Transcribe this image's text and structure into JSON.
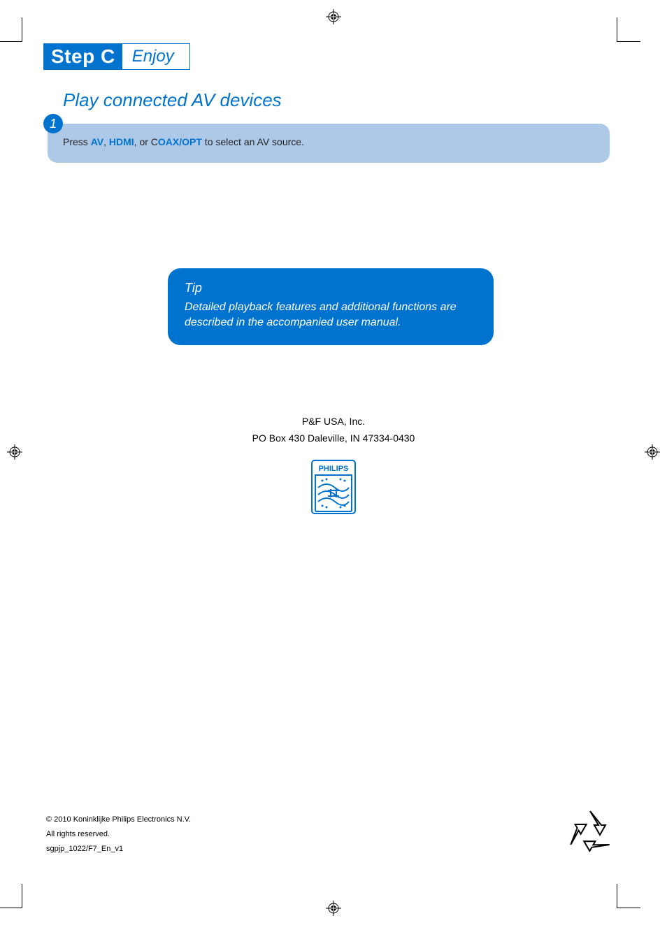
{
  "step": {
    "label": "Step C",
    "action": "Enjoy"
  },
  "section_title": "Play connected AV devices",
  "instruction": {
    "number": "1",
    "prefix": "Press ",
    "k1": "AV",
    "sep1": ", ",
    "k2": "HDMI",
    "sep2": ", or C",
    "k3": "OAX/OPT",
    "suffix": " to select an AV source."
  },
  "tip": {
    "title": "Tip",
    "body": "Detailed playback features and additional functions are described in the accompanied user manual."
  },
  "company": {
    "name": "P&F USA, Inc.",
    "address": "PO Box 430 Daleville, IN 47334-0430"
  },
  "logo_text": "PHILIPS",
  "footer": {
    "copyright": "© 2010 Koninklijke Philips Electronics N.V.",
    "rights": "All rights reserved.",
    "doc_id": "sgpjp_1022/F7_En_v1"
  }
}
